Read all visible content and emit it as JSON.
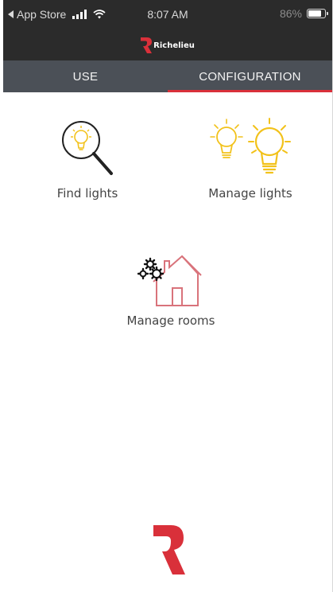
{
  "status_bar": {
    "back_label": "App Store",
    "time": "8:07 AM",
    "battery": "86%",
    "battery_level": 0.86
  },
  "header": {
    "brand": "Richelieu"
  },
  "tabs": [
    {
      "label": "USE",
      "active": false
    },
    {
      "label": "CONFIGURATION",
      "active": true
    }
  ],
  "tiles": {
    "find_lights": {
      "label": "Find lights",
      "icon": "magnifier-bulb-icon"
    },
    "manage_lights": {
      "label": "Manage lights",
      "icon": "bulbs-icon"
    },
    "manage_rooms": {
      "label": "Manage rooms",
      "icon": "house-gears-icon"
    }
  },
  "colors": {
    "header_bg": "#2b2b2b",
    "tab_bg": "#4b5057",
    "accent_red": "#d9303a",
    "bulb_yellow": "#f2c21b",
    "house_pink": "#d9737b"
  }
}
